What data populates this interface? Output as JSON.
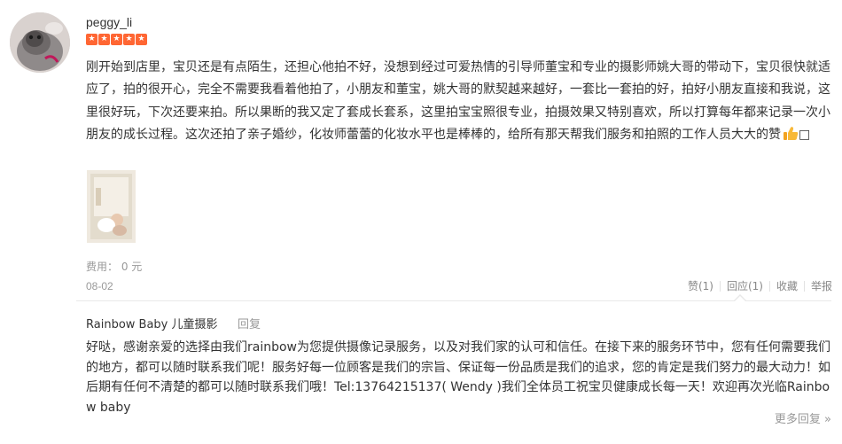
{
  "review": {
    "username": "peggy_li",
    "rating": 5,
    "text": "刚开始到店里，宝贝还是有点陌生，还担心他拍不好，没想到经过可爱热情的引导师董宝和专业的摄影师姚大哥的带动下，宝贝很快就适应了，拍的很开心，完全不需要我看着他拍了，小朋友和董宝，姚大哥的默契越来越好，一套比一套拍的好，拍好小朋友直接和我说，这里很好玩，下次还要来拍。所以果断的我又定了套成长套系，这里拍宝宝照很专业，拍摄效果又特别喜欢，所以打算每年都来记录一次小朋友的成长过程。这次还拍了亲子婚纱，化妆师蕾蕾的化妆水平也是棒棒的，给所有那天帮我们服务和拍照的工作人员大大的赞",
    "emoji_trailing": "□",
    "cost": "费用： 0 元",
    "date": "08-02",
    "actions": {
      "like": "赞(1)",
      "reply": "回应(1)",
      "favorite": "收藏",
      "report": "举报"
    }
  },
  "merchant_reply": {
    "name": "Rainbow Baby 儿童摄影",
    "reply_label": "回复",
    "text": "好哒，感谢亲爱的选择由我们rainbow为您提供摄像记录服务，以及对我们家的认可和信任。在接下来的服务环节中，您有任何需要我们的地方，都可以随时联系我们呢！服务好每一位顾客是我们的宗旨、保证每一份品质是我们的追求，您的肯定是我们努力的最大动力！如后期有任何不清楚的都可以随时联系我们哦！Tel:13764215137( Wendy )我们全体员工祝宝贝健康成长每一天！欢迎再次光临Rainbow baby",
    "more_replies": "更多回复 »"
  },
  "colors": {
    "star": "#ff6633",
    "muted": "#999999",
    "text": "#333333"
  }
}
